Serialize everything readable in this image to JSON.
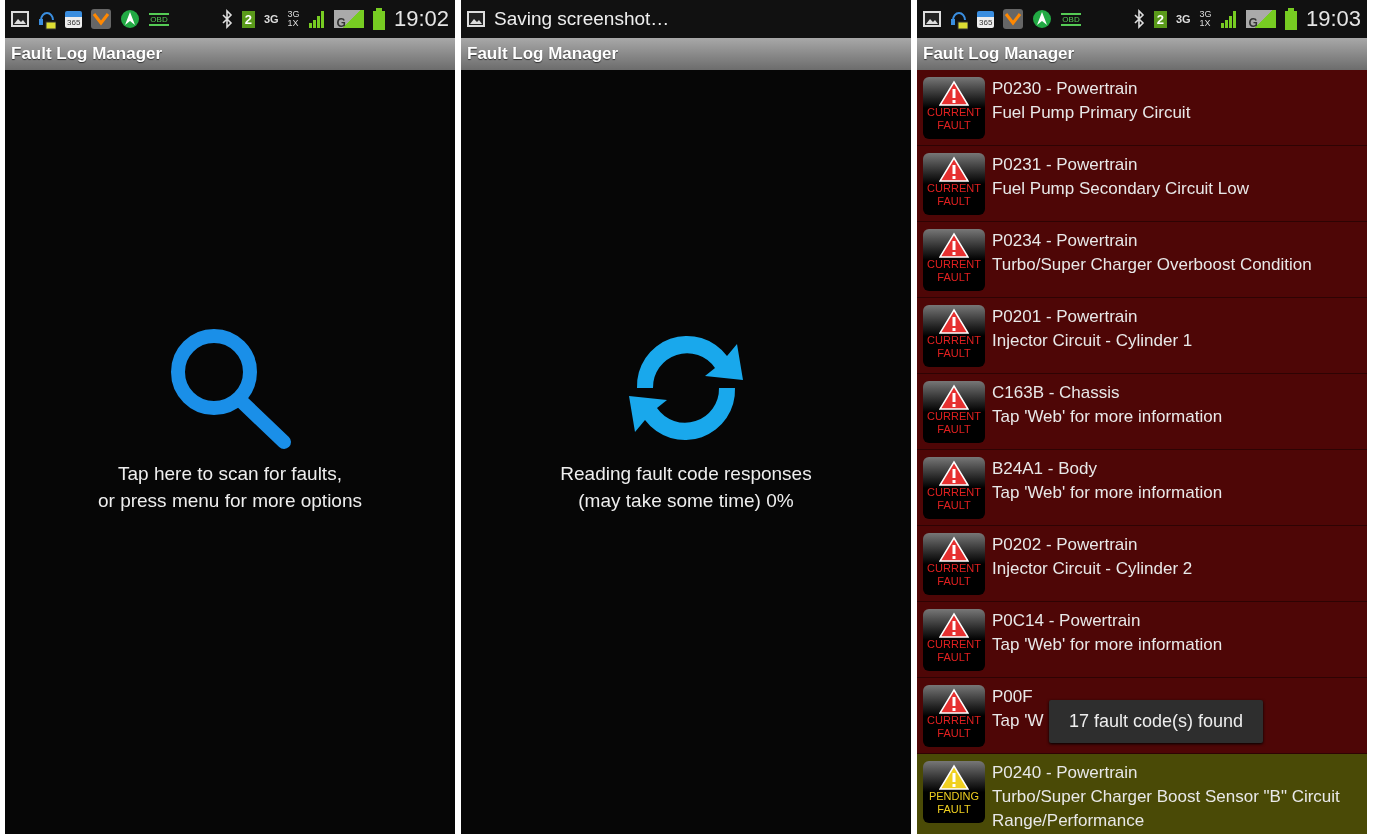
{
  "screens": [
    {
      "kind": "scan",
      "status_bar": {
        "kind": "icons",
        "calendar_text": "365",
        "obd_text": "OBD",
        "sim_text": "2",
        "network_text": "3G",
        "cdma_texts": [
          "3G",
          "1X"
        ],
        "signal_text": "G",
        "time": "19:02"
      },
      "title": "Fault Log Manager",
      "message_lines": [
        "Tap here to scan for faults,",
        "or press menu for more options"
      ]
    },
    {
      "kind": "progress",
      "status_bar": {
        "kind": "notification",
        "notification": "Saving screenshot…"
      },
      "title": "Fault Log Manager",
      "message_lines": [
        "Reading fault code responses",
        "(may take some time) 0%"
      ]
    },
    {
      "kind": "list",
      "status_bar": {
        "kind": "icons",
        "calendar_text": "365",
        "obd_text": "OBD",
        "sim_text": "2",
        "network_text": "3G",
        "cdma_texts": [
          "3G",
          "1X"
        ],
        "signal_text": "G",
        "time": "19:03"
      },
      "title": "Fault Log Manager",
      "faults": [
        {
          "kind": "current",
          "badge_lines": [
            "CURRENT",
            "FAULT"
          ],
          "code": "P0230 - Powertrain",
          "description": "Fuel Pump Primary Circuit"
        },
        {
          "kind": "current",
          "badge_lines": [
            "CURRENT",
            "FAULT"
          ],
          "code": "P0231 - Powertrain",
          "description": "Fuel Pump Secondary Circuit Low"
        },
        {
          "kind": "current",
          "badge_lines": [
            "CURRENT",
            "FAULT"
          ],
          "code": "P0234 - Powertrain",
          "description": "Turbo/Super Charger Overboost Condition"
        },
        {
          "kind": "current",
          "badge_lines": [
            "CURRENT",
            "FAULT"
          ],
          "code": "P0201 - Powertrain",
          "description": "Injector Circuit - Cylinder 1"
        },
        {
          "kind": "current",
          "badge_lines": [
            "CURRENT",
            "FAULT"
          ],
          "code": "C163B - Chassis",
          "description": "Tap 'Web' for more information"
        },
        {
          "kind": "current",
          "badge_lines": [
            "CURRENT",
            "FAULT"
          ],
          "code": "B24A1 - Body",
          "description": "Tap 'Web' for more information"
        },
        {
          "kind": "current",
          "badge_lines": [
            "CURRENT",
            "FAULT"
          ],
          "code": "P0202 - Powertrain",
          "description": "Injector Circuit - Cylinder 2"
        },
        {
          "kind": "current",
          "badge_lines": [
            "CURRENT",
            "FAULT"
          ],
          "code": "P0C14 - Powertrain",
          "description": "Tap 'Web' for more information"
        },
        {
          "kind": "current",
          "badge_lines": [
            "CURRENT",
            "FAULT"
          ],
          "code": "P00F",
          "description": "Tap 'W"
        },
        {
          "kind": "pending",
          "badge_lines": [
            "PENDING",
            "FAULT"
          ],
          "code": "P0240 - Powertrain",
          "description": "Turbo/Super Charger Boost Sensor \"B\" Circuit Range/Performance"
        }
      ],
      "toast": "17 fault code(s) found"
    }
  ]
}
